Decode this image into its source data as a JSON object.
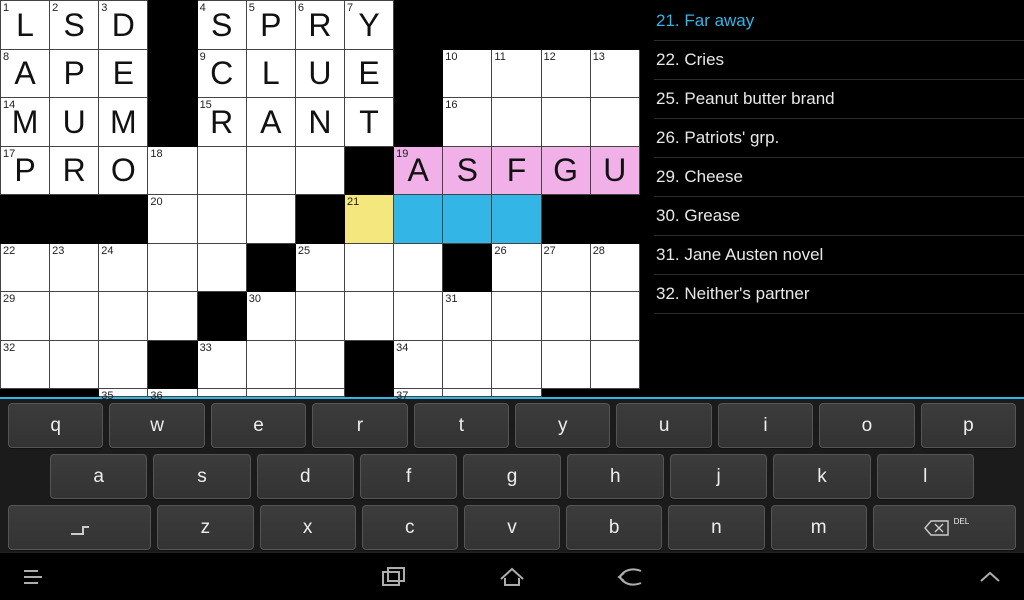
{
  "grid": {
    "rows": 8,
    "cols": 13,
    "cells": [
      [
        {
          "n": "1",
          "l": "L"
        },
        {
          "n": "2",
          "l": "S"
        },
        {
          "n": "3",
          "l": "D"
        },
        {
          "blk": true
        },
        {
          "n": "4",
          "l": "S"
        },
        {
          "n": "5",
          "l": "P"
        },
        {
          "n": "6",
          "l": "R"
        },
        {
          "n": "7",
          "l": "Y"
        },
        {
          "blk": true
        },
        {
          "blk": true
        },
        {
          "blk": true
        },
        {
          "blk": true
        },
        {
          "blk": true
        }
      ],
      [
        {
          "n": "8",
          "l": "A"
        },
        {
          "l": "P"
        },
        {
          "l": "E"
        },
        {
          "blk": true
        },
        {
          "n": "9",
          "l": "C"
        },
        {
          "l": "L"
        },
        {
          "l": "U"
        },
        {
          "l": "E"
        },
        {
          "blk": true
        },
        {
          "n": "10"
        },
        {
          "n": "11"
        },
        {
          "n": "12"
        },
        {
          "n": "13"
        }
      ],
      [
        {
          "n": "14",
          "l": "M"
        },
        {
          "l": "U"
        },
        {
          "l": "M"
        },
        {
          "blk": true
        },
        {
          "n": "15",
          "l": "R"
        },
        {
          "l": "A"
        },
        {
          "l": "N"
        },
        {
          "l": "T"
        },
        {
          "blk": true
        },
        {
          "n": "16"
        },
        {},
        {},
        {}
      ],
      [
        {
          "n": "17",
          "l": "P"
        },
        {
          "l": "R"
        },
        {
          "l": "O"
        },
        {
          "n": "18"
        },
        {},
        {},
        {},
        {
          "blk": true
        },
        {
          "n": "19",
          "l": "A",
          "cls": "pink"
        },
        {
          "l": "S",
          "cls": "pink"
        },
        {
          "l": "F",
          "cls": "pink"
        },
        {
          "l": "G",
          "cls": "pink"
        },
        {
          "l": "U",
          "cls": "pink"
        }
      ],
      [
        {
          "blk": true
        },
        {
          "blk": true
        },
        {
          "blk": true
        },
        {
          "n": "20"
        },
        {},
        {},
        {
          "blk": true
        },
        {
          "n": "21",
          "cls": "cursor"
        },
        {
          "cls": "blue"
        },
        {
          "cls": "blue"
        },
        {
          "cls": "blue"
        },
        {
          "blk": true
        },
        {
          "blk": true
        }
      ],
      [
        {
          "n": "22"
        },
        {
          "n": "23"
        },
        {
          "n": "24"
        },
        {},
        {},
        {
          "blk": true
        },
        {
          "n": "25"
        },
        {},
        {},
        {
          "blk": true
        },
        {
          "n": "26"
        },
        {
          "n": "27"
        },
        {
          "n": "28"
        }
      ],
      [
        {
          "n": "29"
        },
        {},
        {},
        {},
        {
          "blk": true
        },
        {
          "n": "30"
        },
        {},
        {},
        {},
        {
          "n": "31"
        },
        {},
        {},
        {}
      ],
      [
        {
          "n": "32"
        },
        {},
        {},
        {
          "blk": true
        },
        {
          "n": "33"
        },
        {},
        {},
        {
          "blk": true
        },
        {
          "n": "34"
        },
        {},
        {},
        {},
        {}
      ]
    ],
    "lastRow": [
      {
        "blk": true
      },
      {
        "blk": true
      },
      {
        "n": "35"
      },
      {
        "n": "36"
      },
      {},
      {},
      {},
      {
        "blk": true
      },
      {
        "n": "37"
      },
      {},
      {},
      {
        "blk": true
      },
      {
        "blk": true
      }
    ]
  },
  "clues": [
    {
      "n": "21",
      "t": "Far away",
      "sel": true
    },
    {
      "n": "22",
      "t": "Cries"
    },
    {
      "n": "25",
      "t": "Peanut butter brand"
    },
    {
      "n": "26",
      "t": "Patriots' grp."
    },
    {
      "n": "29",
      "t": "Cheese"
    },
    {
      "n": "30",
      "t": "Grease"
    },
    {
      "n": "31",
      "t": "Jane Austen novel"
    },
    {
      "n": "32",
      "t": "Neither's partner"
    }
  ],
  "keyboard": {
    "rows": [
      [
        "q",
        "w",
        "e",
        "r",
        "t",
        "y",
        "u",
        "i",
        "o",
        "p"
      ],
      [
        "a",
        "s",
        "d",
        "f",
        "g",
        "h",
        "j",
        "k",
        "l"
      ],
      [
        "⌐",
        "z",
        "x",
        "c",
        "v",
        "b",
        "n",
        "m",
        "DEL"
      ]
    ],
    "delLabel": "DEL"
  },
  "colors": {
    "accent": "#33b5e5",
    "pink": "#f1b1e8",
    "cursor": "#f4e77d"
  }
}
